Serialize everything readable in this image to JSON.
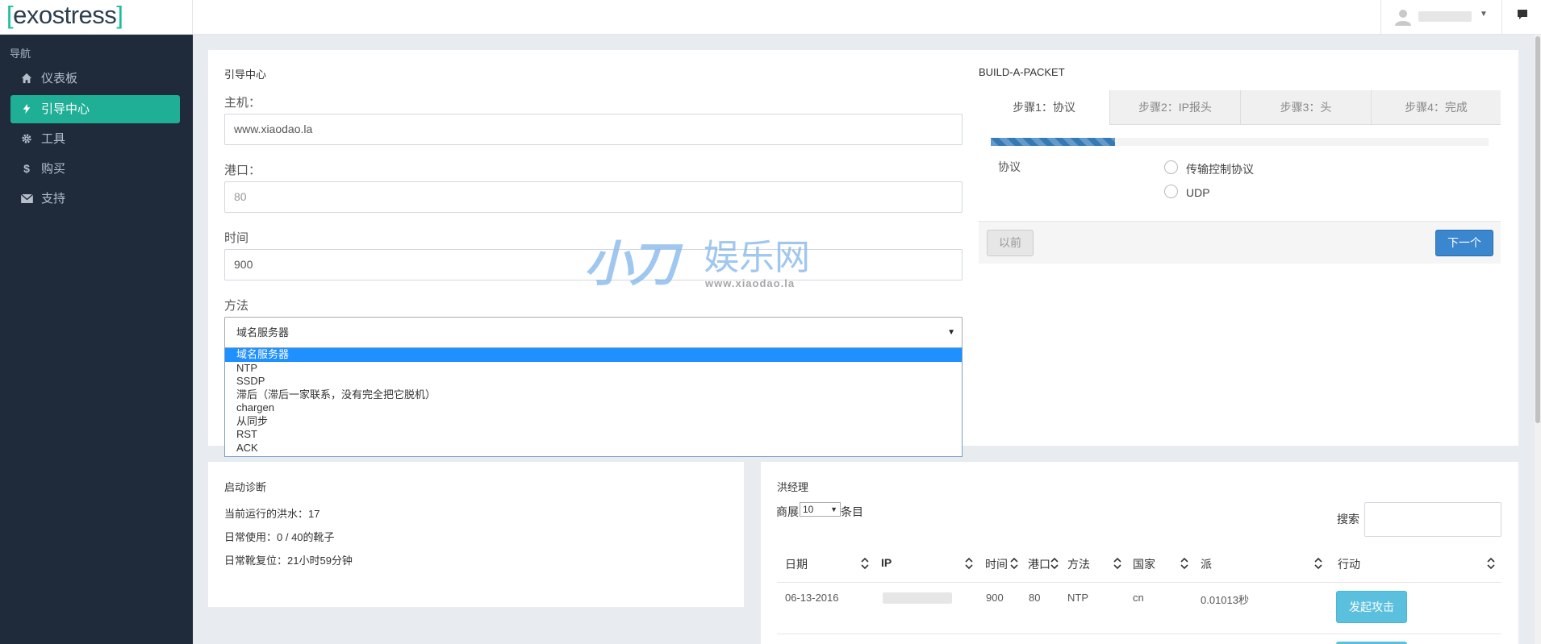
{
  "app": {
    "logo_bracket_open": "[",
    "logo_text": "exostress",
    "logo_bracket_close": "]"
  },
  "colors": {
    "sidebar_bg": "#1f2a3a",
    "accent": "#1fae96",
    "primary": "#3a86cf",
    "info": "#5bc0de"
  },
  "sidebar": {
    "title": "导航",
    "items": [
      {
        "label": "仪表板",
        "icon": "home-icon"
      },
      {
        "label": "引导中心",
        "icon": "bolt-icon",
        "active": true
      },
      {
        "label": "工具",
        "icon": "gear-icon"
      },
      {
        "label": "购买",
        "icon": "dollar-icon"
      },
      {
        "label": "支持",
        "icon": "envelope-icon"
      }
    ]
  },
  "boot_form": {
    "title": "引导中心",
    "host_label": "主机：",
    "host_value": "www.xiaodao.la",
    "port_label": "港口：",
    "port_placeholder": "80",
    "time_label": "时间",
    "time_value": "900",
    "method_label": "方法",
    "method_selected": "域名服务器",
    "method_options": [
      "域名服务器",
      "NTP",
      "SSDP",
      "滞后（滞后一家联系，没有完全把它脱机）",
      "chargen",
      "从同步",
      "RST",
      "ACK"
    ]
  },
  "packet": {
    "title": "BUILD-A-PACKET",
    "tabs": [
      "步骤1：协议",
      "步骤2：IP报头",
      "步骤3：头",
      "步骤4：完成"
    ],
    "progress": 0.25,
    "protocol_label": "协议",
    "options": [
      "传输控制协议",
      "UDP"
    ],
    "prev_label": "以前",
    "next_label": "下一个"
  },
  "watermark": {
    "big": "小刀",
    "mid": "娱乐网",
    "url": "www.xiaodao.la"
  },
  "diagnostics": {
    "title": "启动诊断",
    "lines": [
      "当前运行的洪水：17",
      "日常使用：0 / 40的靴子",
      "日常靴复位：21小时59分钟"
    ]
  },
  "flood": {
    "title": "洪经理",
    "show_prefix": "商展",
    "page_size": "10",
    "show_suffix": "条目",
    "search_label": "搜索",
    "columns": [
      "日期",
      "IP",
      "时间",
      "港口",
      "方法",
      "国家",
      "派",
      "行动"
    ],
    "rows": [
      {
        "date": "06-13-2016",
        "ip": "",
        "time": "900",
        "port": "80",
        "method": "NTP",
        "country": "cn",
        "sent": "0.01013秒",
        "action": "发起攻击"
      }
    ]
  }
}
